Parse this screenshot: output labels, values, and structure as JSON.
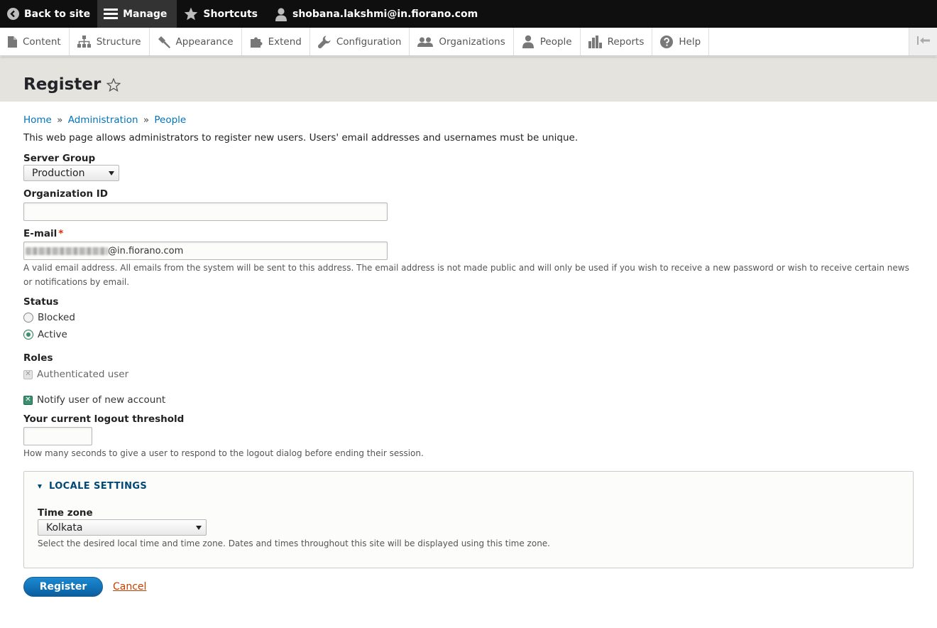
{
  "toolbar": {
    "back_label": "Back to site",
    "manage_label": "Manage",
    "shortcuts_label": "Shortcuts",
    "user_label": "shobana.lakshmi@in.fiorano.com"
  },
  "admin_menu": {
    "items": [
      {
        "label": "Content",
        "icon": "file-icon"
      },
      {
        "label": "Structure",
        "icon": "sitemap-icon"
      },
      {
        "label": "Appearance",
        "icon": "paint-icon"
      },
      {
        "label": "Extend",
        "icon": "puzzle-icon"
      },
      {
        "label": "Configuration",
        "icon": "wrench-icon"
      },
      {
        "label": "Organizations",
        "icon": "group-icon"
      },
      {
        "label": "People",
        "icon": "person-icon"
      },
      {
        "label": "Reports",
        "icon": "bar-chart-icon"
      },
      {
        "label": "Help",
        "icon": "help-icon"
      }
    ]
  },
  "page": {
    "title": "Register"
  },
  "breadcrumb": {
    "items": [
      "Home",
      "Administration",
      "People"
    ],
    "separator": "»"
  },
  "intro": "This web page allows administrators to register new users. Users' email addresses and usernames must be unique.",
  "form": {
    "server_group": {
      "label": "Server Group",
      "value": "Production"
    },
    "organization_id": {
      "label": "Organization ID",
      "value": ""
    },
    "email": {
      "label": "E-mail",
      "required_marker": "*",
      "value_suffix": "@in.fiorano.com",
      "description": "A valid email address. All emails from the system will be sent to this address. The email address is not made public and will only be used if you wish to receive a new password or wish to receive certain news or notifications by email."
    },
    "status": {
      "label": "Status",
      "options": [
        "Blocked",
        "Active"
      ],
      "selected": "Active"
    },
    "roles": {
      "label": "Roles",
      "options": [
        "Authenticated user"
      ]
    },
    "notify": {
      "label": "Notify user of new account",
      "checked": true
    },
    "logout_threshold": {
      "label": "Your current logout threshold",
      "value": "",
      "description": "How many seconds to give a user to respond to the logout dialog before ending their session."
    },
    "locale": {
      "summary": "LOCALE SETTINGS",
      "timezone_label": "Time zone",
      "timezone_value": "Kolkata",
      "timezone_description": "Select the desired local time and time zone. Dates and times throughout this site will be displayed using this time zone."
    }
  },
  "actions": {
    "submit_label": "Register",
    "cancel_label": "Cancel"
  },
  "colors": {
    "toolbar_bg": "#0f0f0f",
    "header_bg": "#e4e3de",
    "link": "#0074bd",
    "primary_button": "#0a6ebd",
    "required": "#e32700"
  }
}
